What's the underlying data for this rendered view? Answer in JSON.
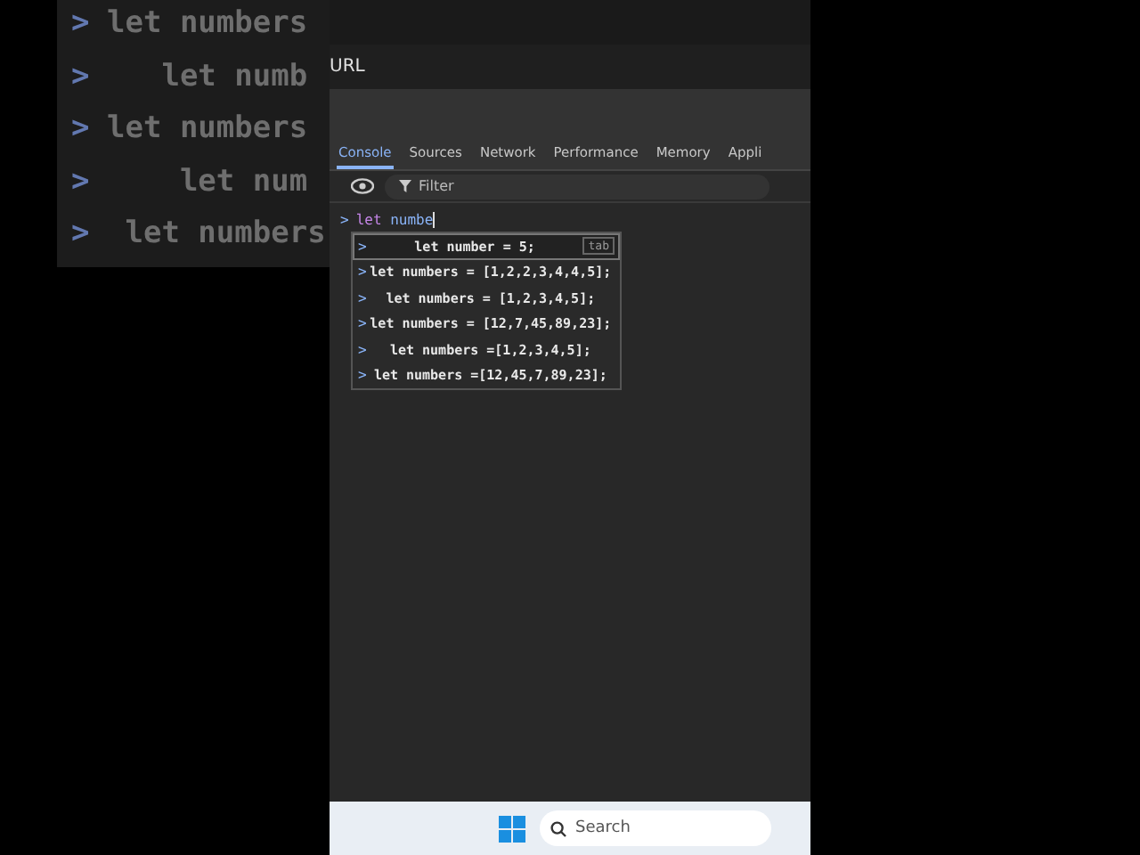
{
  "zoom_overlay": {
    "lines": [
      {
        "prompt": ">",
        "text": "let numbers"
      },
      {
        "prompt": ">",
        "text": "   let numb"
      },
      {
        "prompt": ">",
        "text": "let numbers"
      },
      {
        "prompt": ">",
        "text": "    let num"
      },
      {
        "prompt": ">",
        "text": " let numbers"
      }
    ]
  },
  "address_bar": {
    "text": "URL"
  },
  "tabs": [
    {
      "label": "Console",
      "selected": true
    },
    {
      "label": "Sources",
      "selected": false
    },
    {
      "label": "Network",
      "selected": false
    },
    {
      "label": "Performance",
      "selected": false
    },
    {
      "label": "Memory",
      "selected": false
    },
    {
      "label": "Appli",
      "selected": false
    }
  ],
  "toolbar": {
    "filter_placeholder": "Filter"
  },
  "console": {
    "prompt": ">",
    "input_keyword": "let",
    "input_rest": "numbe",
    "suggestions": [
      {
        "prompt": ">",
        "text": "let number = 5;",
        "hint": "tab",
        "selected": true
      },
      {
        "prompt": ">",
        "text": "let numbers = [1,2,2,3,4,4,5];",
        "selected": false
      },
      {
        "prompt": ">",
        "text": "let numbers = [1,2,3,4,5];",
        "selected": false
      },
      {
        "prompt": ">",
        "text": "let numbers = [12,7,45,89,23];",
        "selected": false
      },
      {
        "prompt": ">",
        "text": "let numbers =[1,2,3,4,5];",
        "selected": false
      },
      {
        "prompt": ">",
        "text": "let numbers =[12,45,7,89,23];",
        "selected": false
      }
    ]
  },
  "taskbar": {
    "search_placeholder": "Search"
  }
}
